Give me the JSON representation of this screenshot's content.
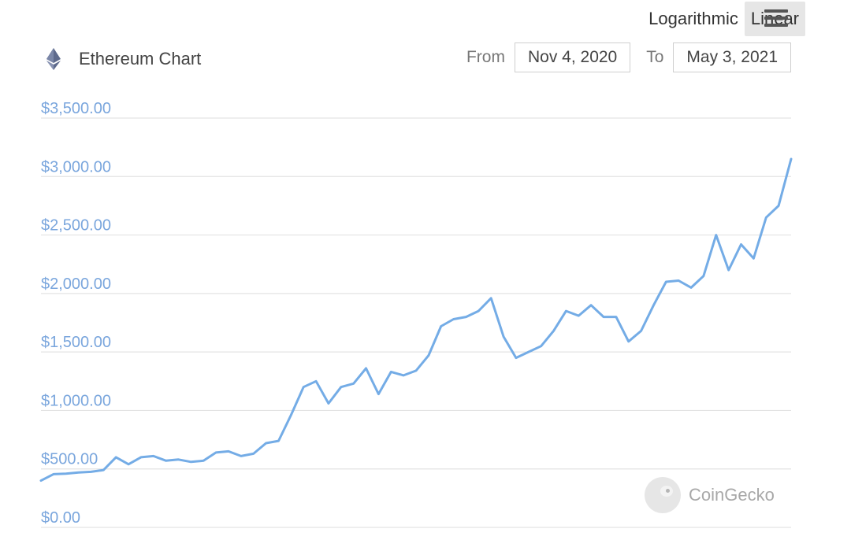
{
  "toolbar": {
    "logarithmic_label": "Logarithmic",
    "linear_label": "Linear",
    "active_scale": "Linear",
    "menu_icon": "hamburger-menu-icon"
  },
  "header": {
    "title": "Ethereum Chart",
    "icon": "ethereum-icon"
  },
  "date_range": {
    "from_label": "From",
    "from_value": "Nov 4, 2020",
    "to_label": "To",
    "to_value": "May 3, 2021"
  },
  "watermark": {
    "text": "CoinGecko",
    "icon": "coingecko-logo-icon"
  },
  "colors": {
    "line": "#74ace6",
    "tick_label": "#7aa6dd",
    "grid": "#e3e3e3"
  },
  "chart_data": {
    "type": "line",
    "title": "Ethereum Chart",
    "x_range": [
      "Nov 4, 2020",
      "May 3, 2021"
    ],
    "ylim": [
      0,
      3500
    ],
    "y_scale": "linear",
    "yticks": [
      "$0.00",
      "$500.00",
      "$1,000.00",
      "$1,500.00",
      "$2,000.00",
      "$2,500.00",
      "$3,000.00",
      "$3,500.00"
    ],
    "ytick_values": [
      0,
      500,
      1000,
      1500,
      2000,
      2500,
      3000,
      3500
    ],
    "grid": true,
    "legend": "none",
    "series": [
      {
        "x": [
          "2020-11-04",
          "2020-11-07",
          "2020-11-10",
          "2020-11-13",
          "2020-11-16",
          "2020-11-19",
          "2020-11-22",
          "2020-11-25",
          "2020-11-28",
          "2020-12-01",
          "2020-12-04",
          "2020-12-07",
          "2020-12-10",
          "2020-12-13",
          "2020-12-16",
          "2020-12-19",
          "2020-12-22",
          "2020-12-25",
          "2020-12-28",
          "2020-12-31",
          "2021-01-03",
          "2021-01-06",
          "2021-01-09",
          "2021-01-12",
          "2021-01-15",
          "2021-01-18",
          "2021-01-21",
          "2021-01-24",
          "2021-01-27",
          "2021-01-30",
          "2021-02-02",
          "2021-02-05",
          "2021-02-08",
          "2021-02-11",
          "2021-02-14",
          "2021-02-17",
          "2021-02-20",
          "2021-02-23",
          "2021-02-26",
          "2021-03-01",
          "2021-03-04",
          "2021-03-07",
          "2021-03-10",
          "2021-03-13",
          "2021-03-16",
          "2021-03-19",
          "2021-03-22",
          "2021-03-25",
          "2021-03-28",
          "2021-03-31",
          "2021-04-03",
          "2021-04-06",
          "2021-04-09",
          "2021-04-12",
          "2021-04-15",
          "2021-04-18",
          "2021-04-21",
          "2021-04-24",
          "2021-04-27",
          "2021-04-30",
          "2021-05-03"
        ],
        "values": [
          400,
          455,
          460,
          470,
          475,
          490,
          600,
          540,
          600,
          610,
          570,
          580,
          560,
          570,
          640,
          650,
          610,
          630,
          720,
          740,
          960,
          1200,
          1250,
          1060,
          1200,
          1230,
          1360,
          1140,
          1330,
          1300,
          1340,
          1470,
          1720,
          1780,
          1800,
          1850,
          1960,
          1630,
          1450,
          1500,
          1550,
          1680,
          1850,
          1810,
          1900,
          1800,
          1800,
          1590,
          1680,
          1900,
          2100,
          2110,
          2050,
          2150,
          2500,
          2200,
          2420,
          2300,
          2650,
          2750,
          3150
        ]
      }
    ]
  }
}
